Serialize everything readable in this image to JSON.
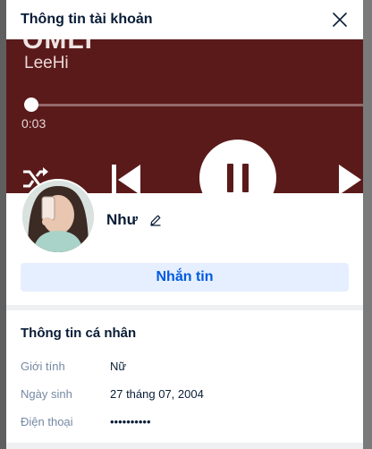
{
  "header": {
    "title": "Thông tin tài khoản"
  },
  "player": {
    "song_title_partial": "OMLI",
    "artist": "LeeHi",
    "elapsed": "0:03",
    "progress": 0.02
  },
  "profile": {
    "name": "Như",
    "message_button": "Nhắn tin"
  },
  "personal_info": {
    "title": "Thông tin cá nhân",
    "rows": [
      {
        "label": "Giới tính",
        "value": "Nữ"
      },
      {
        "label": "Ngày sinh",
        "value": "27 tháng 07, 2004"
      },
      {
        "label": "Điện thoại",
        "value": "••••••••••"
      }
    ]
  },
  "colors": {
    "accent": "#005ae0",
    "accent_bg": "#e5efff",
    "cover_bg": "#5b1a1a",
    "text_primary": "#081c36",
    "text_secondary": "#7589a3"
  },
  "icons": [
    "close-icon",
    "shuffle-icon",
    "previous-icon",
    "pause-icon",
    "next-icon",
    "pencil-icon",
    "avatar"
  ]
}
